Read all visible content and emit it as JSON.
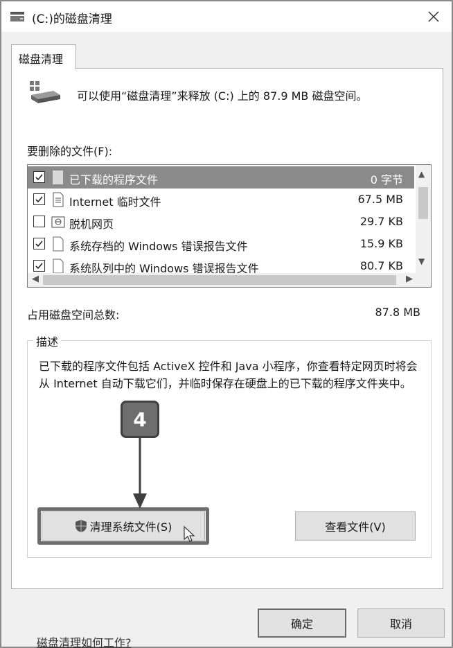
{
  "window": {
    "title": "(C:)的磁盘清理"
  },
  "tab": {
    "label": "磁盘清理"
  },
  "intro": {
    "text": "可以使用“磁盘清理”来释放  (C:) 上的 87.9 MB 磁盘空间。"
  },
  "files": {
    "label": "要删除的文件(F):",
    "items": [
      {
        "checked": true,
        "icon": "blank-file-icon",
        "name": "已下载的程序文件",
        "size": "0 字节",
        "selected": true
      },
      {
        "checked": true,
        "icon": "text-file-icon",
        "name": "Internet 临时文件",
        "size": "67.5 MB",
        "selected": false
      },
      {
        "checked": false,
        "icon": "offline-page-icon",
        "name": "脱机网页",
        "size": "29.7 KB",
        "selected": false
      },
      {
        "checked": true,
        "icon": "file-icon",
        "name": "系统存档的 Windows 错误报告文件",
        "size": "15.9 KB",
        "selected": false
      },
      {
        "checked": true,
        "icon": "file-icon",
        "name": "系统队列中的 Windows 错误报告文件",
        "size": "80.7 KB",
        "selected": false
      }
    ]
  },
  "total": {
    "label": "占用磁盘空间总数:",
    "value": "87.8 MB"
  },
  "description": {
    "legend": "描述",
    "text": "已下载的程序文件包括 ActiveX 控件和 Java 小程序，你查看特定网页时将会从 Internet 自动下载它们，并临时保存在硬盘上的已下载的程序文件夹中。"
  },
  "step_badge": "4",
  "buttons": {
    "clean_system": "清理系统文件(S)",
    "view_files": "查看文件(V)",
    "ok": "确定",
    "cancel": "取消"
  },
  "help_link": "磁盘清理如何工作?",
  "colors": {
    "selected_row": "#8a8a8a",
    "badge": "#6e6e6e",
    "button": "#e1e1e1"
  }
}
